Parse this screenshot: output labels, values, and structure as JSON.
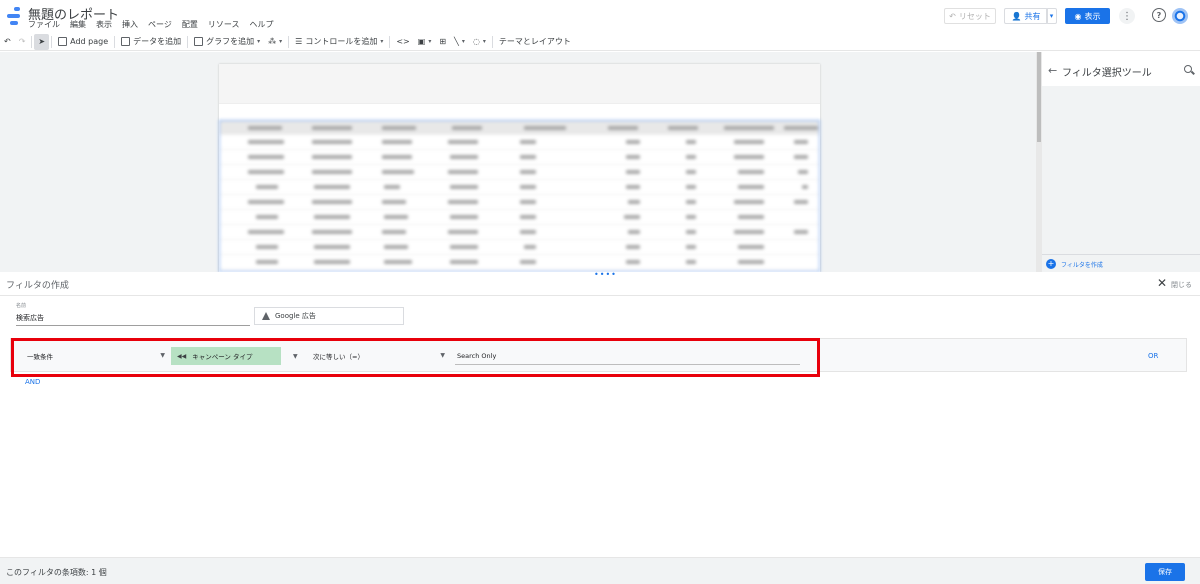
{
  "header": {
    "title": "無題のレポート",
    "menu": [
      "ファイル",
      "編集",
      "表示",
      "挿入",
      "ページ",
      "配置",
      "リソース",
      "ヘルプ"
    ],
    "reset_label": "リセット",
    "share_label": "共有",
    "view_label": "表示"
  },
  "toolbar": {
    "add_page": "Add page",
    "add_data": "データを追加",
    "add_chart": "グラフを追加",
    "add_control": "コントロールを追加",
    "theme_layout": "テーマとレイアウト"
  },
  "right_panel": {
    "title": "フィルタ選択ツール",
    "create_filter": "フィルタを作成"
  },
  "filter_editor": {
    "title": "フィルタの作成",
    "close_label": "閉じる",
    "name_label": "名前",
    "name_value": "検索広告",
    "data_source": "Google 広告",
    "condition": {
      "include_mode": "一致条件",
      "dimension_icon": "ads-dimension-icon",
      "dimension": "キャンペーン タイプ",
      "operator": "次に等しい（=）",
      "value": "Search Only"
    },
    "or_label": "OR",
    "and_label": "AND",
    "clause_count": "このフィルタの条項数: 1 個",
    "save_label": "保存"
  },
  "colors": {
    "accent": "#1a73e8",
    "dimension_chip": "#b7e1c3",
    "highlight": "#e8000b"
  }
}
